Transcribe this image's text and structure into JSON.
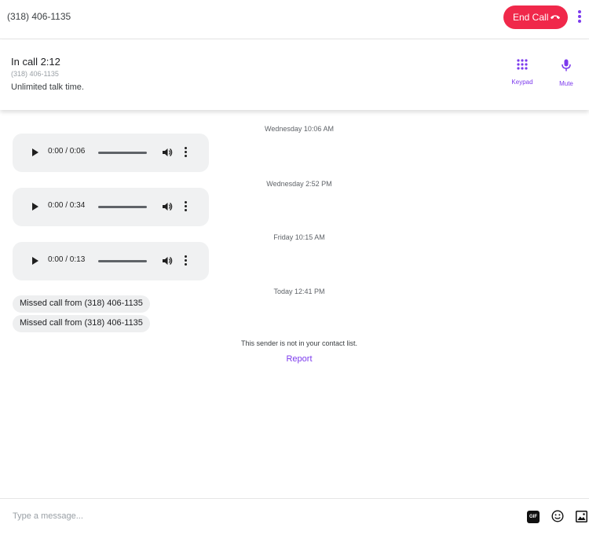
{
  "header": {
    "phone_number": "(318) 406-1135",
    "end_call_label": "End Call"
  },
  "call": {
    "status": "In call 2:12",
    "number": "(318) 406-1135",
    "plan": "Unlimited talk time.",
    "keypad_label": "Keypad",
    "mute_label": "Mute"
  },
  "thread": {
    "items": [
      {
        "timestamp": "Wednesday 10:06 AM",
        "audio_time": "0:00 / 0:06"
      },
      {
        "timestamp": "Wednesday 2:52 PM",
        "audio_time": "0:00 / 0:34"
      },
      {
        "timestamp": "Friday 10:15 AM",
        "audio_time": "0:00 / 0:13"
      }
    ],
    "missed_timestamp": "Today 12:41 PM",
    "missed_calls": [
      "Missed call from (318) 406-1135",
      "Missed call from (318) 406-1135"
    ],
    "sender_notice": "This sender is not in your contact list.",
    "report_label": "Report"
  },
  "composer": {
    "placeholder": "Type a message...",
    "gif_label": "GIF"
  },
  "colors": {
    "accent": "#7c3aed",
    "end_call": "#f0284a",
    "bubble": "#eeeff0"
  }
}
